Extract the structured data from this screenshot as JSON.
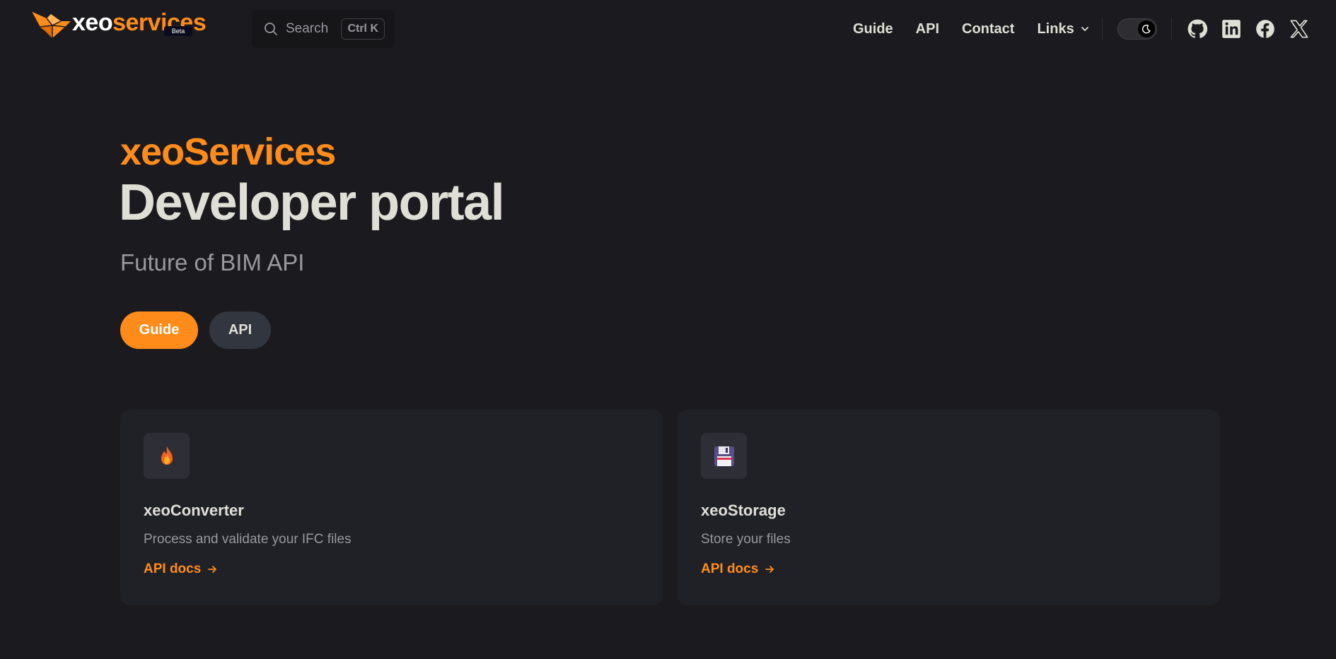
{
  "header": {
    "logo_part1": "xeo",
    "logo_part2": "services",
    "badge": "Beta",
    "search": {
      "label": "Search",
      "shortcut": "Ctrl K"
    },
    "nav": {
      "guide": "Guide",
      "api": "API",
      "contact": "Contact",
      "links": "Links"
    },
    "theme_toggle": "dark",
    "social_icons": [
      "github-icon",
      "linkedin-icon",
      "facebook-icon",
      "x-icon"
    ]
  },
  "hero": {
    "name": "xeoServices",
    "title": "Developer portal",
    "tagline": "Future of BIM API",
    "actions": {
      "primary": "Guide",
      "secondary": "API"
    }
  },
  "features": [
    {
      "icon": "fire-icon",
      "title": "xeoConverter",
      "description": "Process and validate your IFC files",
      "link": "API docs"
    },
    {
      "icon": "floppy-disk-icon",
      "title": "xeoStorage",
      "description": "Store your files",
      "link": "API docs"
    }
  ],
  "colors": {
    "accent": "#ff8c1a",
    "background": "#1b1b1f",
    "card": "#202127",
    "text": "#dfdfd6",
    "muted": "#98989f"
  }
}
